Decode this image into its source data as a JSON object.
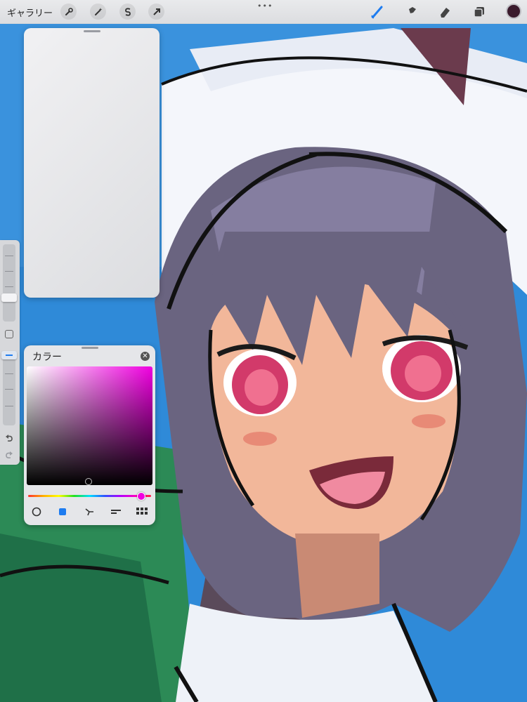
{
  "toolbar": {
    "gallery_label": "ギャラリー",
    "more_label": "•••",
    "left_icons": [
      "wrench-icon",
      "magic-wand-icon",
      "selection-s-icon",
      "transform-arrow-icon"
    ],
    "right_icons": [
      "brush-icon",
      "smudge-icon",
      "eraser-icon",
      "layers-icon"
    ],
    "current_color": "#3a1a2c",
    "accent": "#1e7cf0"
  },
  "sidebar": {
    "items": [
      "brush-size-slider",
      "modify-button",
      "opacity-slider",
      "undo-icon",
      "redo-icon"
    ]
  },
  "color_panel": {
    "title": "カラー",
    "hue_color": "#f000e0",
    "tabs": [
      "disc",
      "classic",
      "harmony",
      "value",
      "palettes"
    ],
    "active_tab": "classic"
  }
}
